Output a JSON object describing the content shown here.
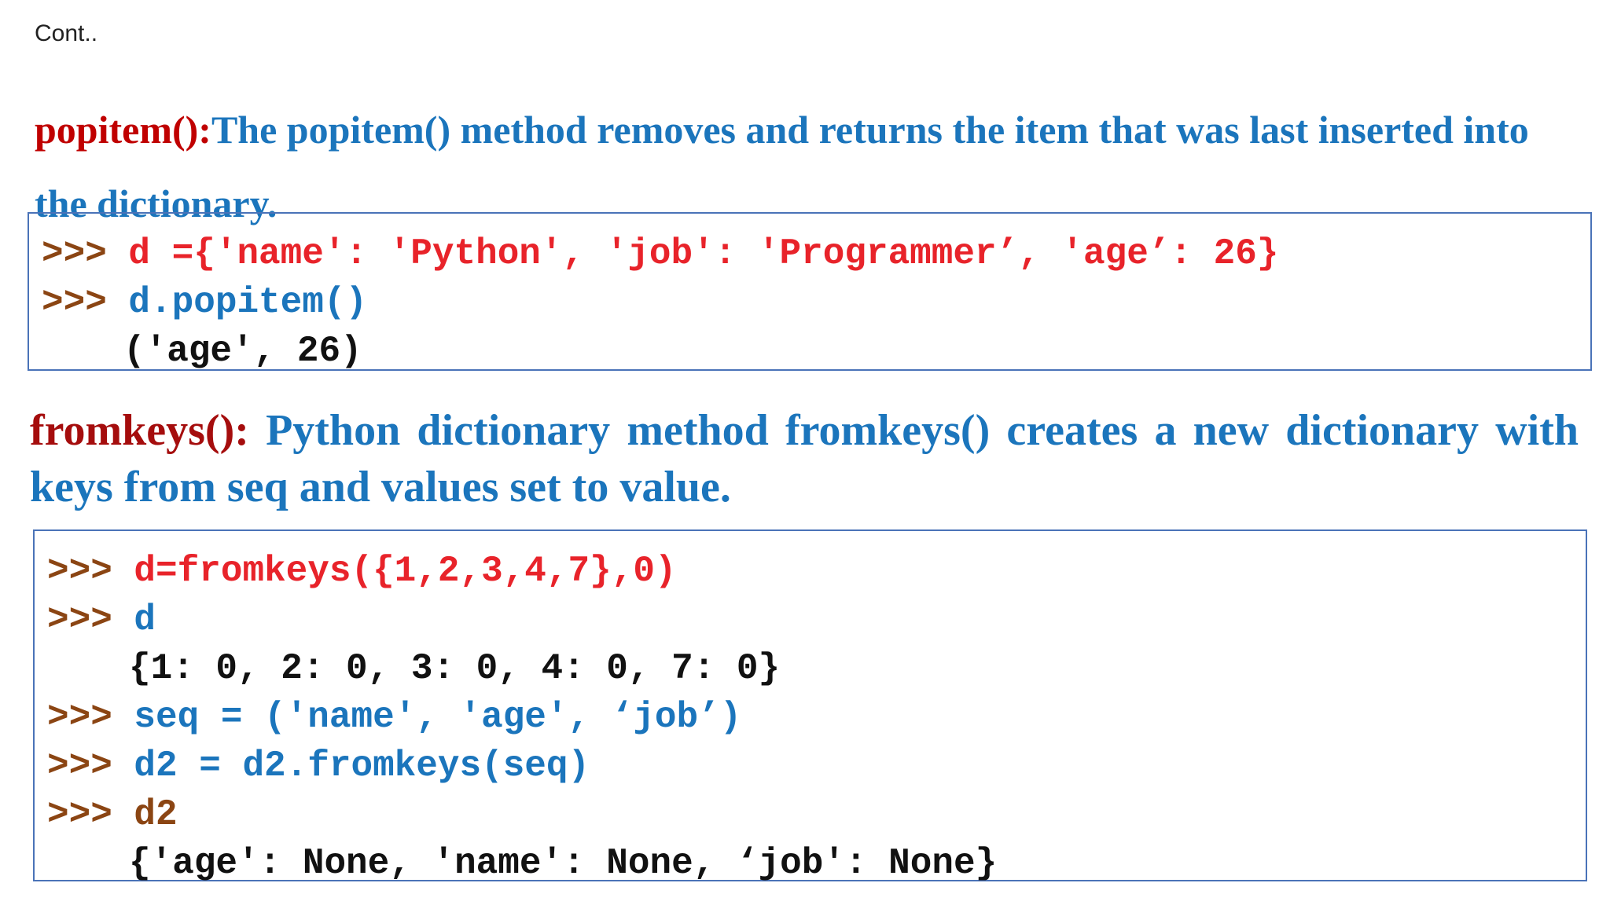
{
  "header": {
    "cont": "Cont.."
  },
  "popitem": {
    "name": "popitem():",
    "desc": "The popitem() method removes and returns the item that was last inserted into the dictionary.",
    "code": [
      {
        "prompt": ">>> ",
        "text": "d ={'name': 'Python', 'job': 'Programmer’, 'age’: 26}",
        "style": "red"
      },
      {
        "prompt": ">>> ",
        "text": "d.popitem()",
        "style": "blue"
      },
      {
        "prompt": "",
        "text": "('age', 26)",
        "style": "out"
      }
    ]
  },
  "fromkeys": {
    "name": "fromkeys():",
    "desc": " Python dictionary method fromkeys() creates a new dictionary with keys from seq and values set to value.",
    "code": [
      {
        "prompt": ">>> ",
        "text": "d=fromkeys({1,2,3,4,7},0)",
        "style": "red"
      },
      {
        "prompt": ">>> ",
        "text": "d",
        "style": "blue"
      },
      {
        "prompt": "",
        "text": "{1: 0, 2: 0, 3: 0, 4: 0, 7: 0}",
        "style": "out"
      },
      {
        "prompt": ">>> ",
        "text": "seq = ('name', 'age', ‘job’)",
        "style": "blue"
      },
      {
        "prompt": ">>> ",
        "text": "d2 = d2.fromkeys(seq)",
        "style": "blue"
      },
      {
        "prompt": ">>> ",
        "text": "d2",
        "style": "brown"
      },
      {
        "prompt": "",
        "text": "{'age': None, 'name': None, ‘job': None}",
        "style": "out"
      }
    ]
  },
  "colors": {
    "accent_blue": "#1b75bc",
    "keyword_red": "#c00000",
    "code_red": "#e8232a",
    "prompt_brown": "#8b4513",
    "border_blue": "#4a73b8"
  }
}
